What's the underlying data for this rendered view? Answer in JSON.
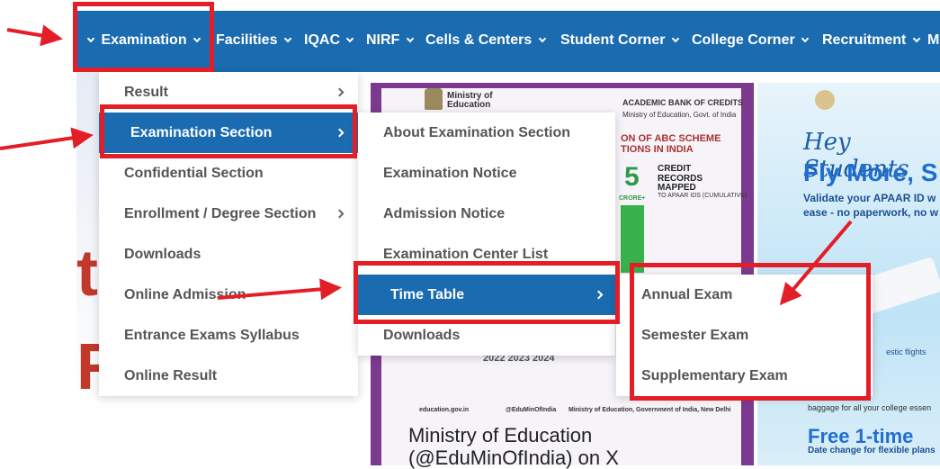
{
  "nav": {
    "items": [
      {
        "label": "Examination"
      },
      {
        "label": "Facilities"
      },
      {
        "label": "IQAC"
      },
      {
        "label": "NIRF"
      },
      {
        "label": "Cells & Centers"
      },
      {
        "label": "Student Corner"
      },
      {
        "label": "College Corner"
      },
      {
        "label": "Recruitment"
      },
      {
        "label": "M"
      }
    ]
  },
  "menu_level1": {
    "items": [
      {
        "label": "Result"
      },
      {
        "label": "Examination Section"
      },
      {
        "label": "Confidential Section"
      },
      {
        "label": "Enrollment / Degree Section"
      },
      {
        "label": "Downloads"
      },
      {
        "label": "Online Admission"
      },
      {
        "label": "Entrance Exams Syllabus"
      },
      {
        "label": "Online Result"
      }
    ]
  },
  "menu_level2": {
    "items": [
      {
        "label": "About Examination Section"
      },
      {
        "label": "Examination Notice"
      },
      {
        "label": "Admission Notice"
      },
      {
        "label": "Examination Center List"
      },
      {
        "label": "Time Table"
      },
      {
        "label": "Downloads"
      }
    ]
  },
  "menu_level3": {
    "items": [
      {
        "label": "Annual Exam"
      },
      {
        "label": "Semester Exam"
      },
      {
        "label": "Supplementary Exam"
      }
    ]
  },
  "banners": {
    "moe_header": "Ministry of Education",
    "abc_header": "ACADEMIC BANK OF CREDITS",
    "abc_sub": "Ministry of Education, Govt. of India",
    "abc_scheme": "ON OF ABC SCHEME",
    "abc_scheme2": "TIONS IN INDIA",
    "credit_number": "5",
    "credit_text": "CREDIT RECORDS MAPPED",
    "credit_sub": "TO APAAR IDS (CUMULATIVE)",
    "crore": "CRORE+",
    "years": "2022     2023     2024",
    "footer_site": "education.gov.in",
    "footer_handle": "@EduMinOfIndia",
    "footer_ministry": "Ministry of Education, Government of India, New Delhi",
    "moe_bottom_line1": "Ministry of Education",
    "moe_bottom_line2": "(@EduMinOfIndia) on X",
    "hey": "Hey Students",
    "fly": "Fly More, S",
    "validate_line1": "Validate your APAAR ID w",
    "validate_line2": "ease - no paperwork, no w",
    "domestic": "estic flights",
    "baggage": "baggage for all your college essen",
    "free": "Free 1-time",
    "date_change": "Date change for flexible plans",
    "left_letter_1": "t",
    "left_letter_2": "R"
  },
  "colors": {
    "nav_bg": "#1b6bb0",
    "active_item_bg": "#1b6bb0",
    "annotation_red": "#e41e26",
    "menu_text": "#555555"
  }
}
